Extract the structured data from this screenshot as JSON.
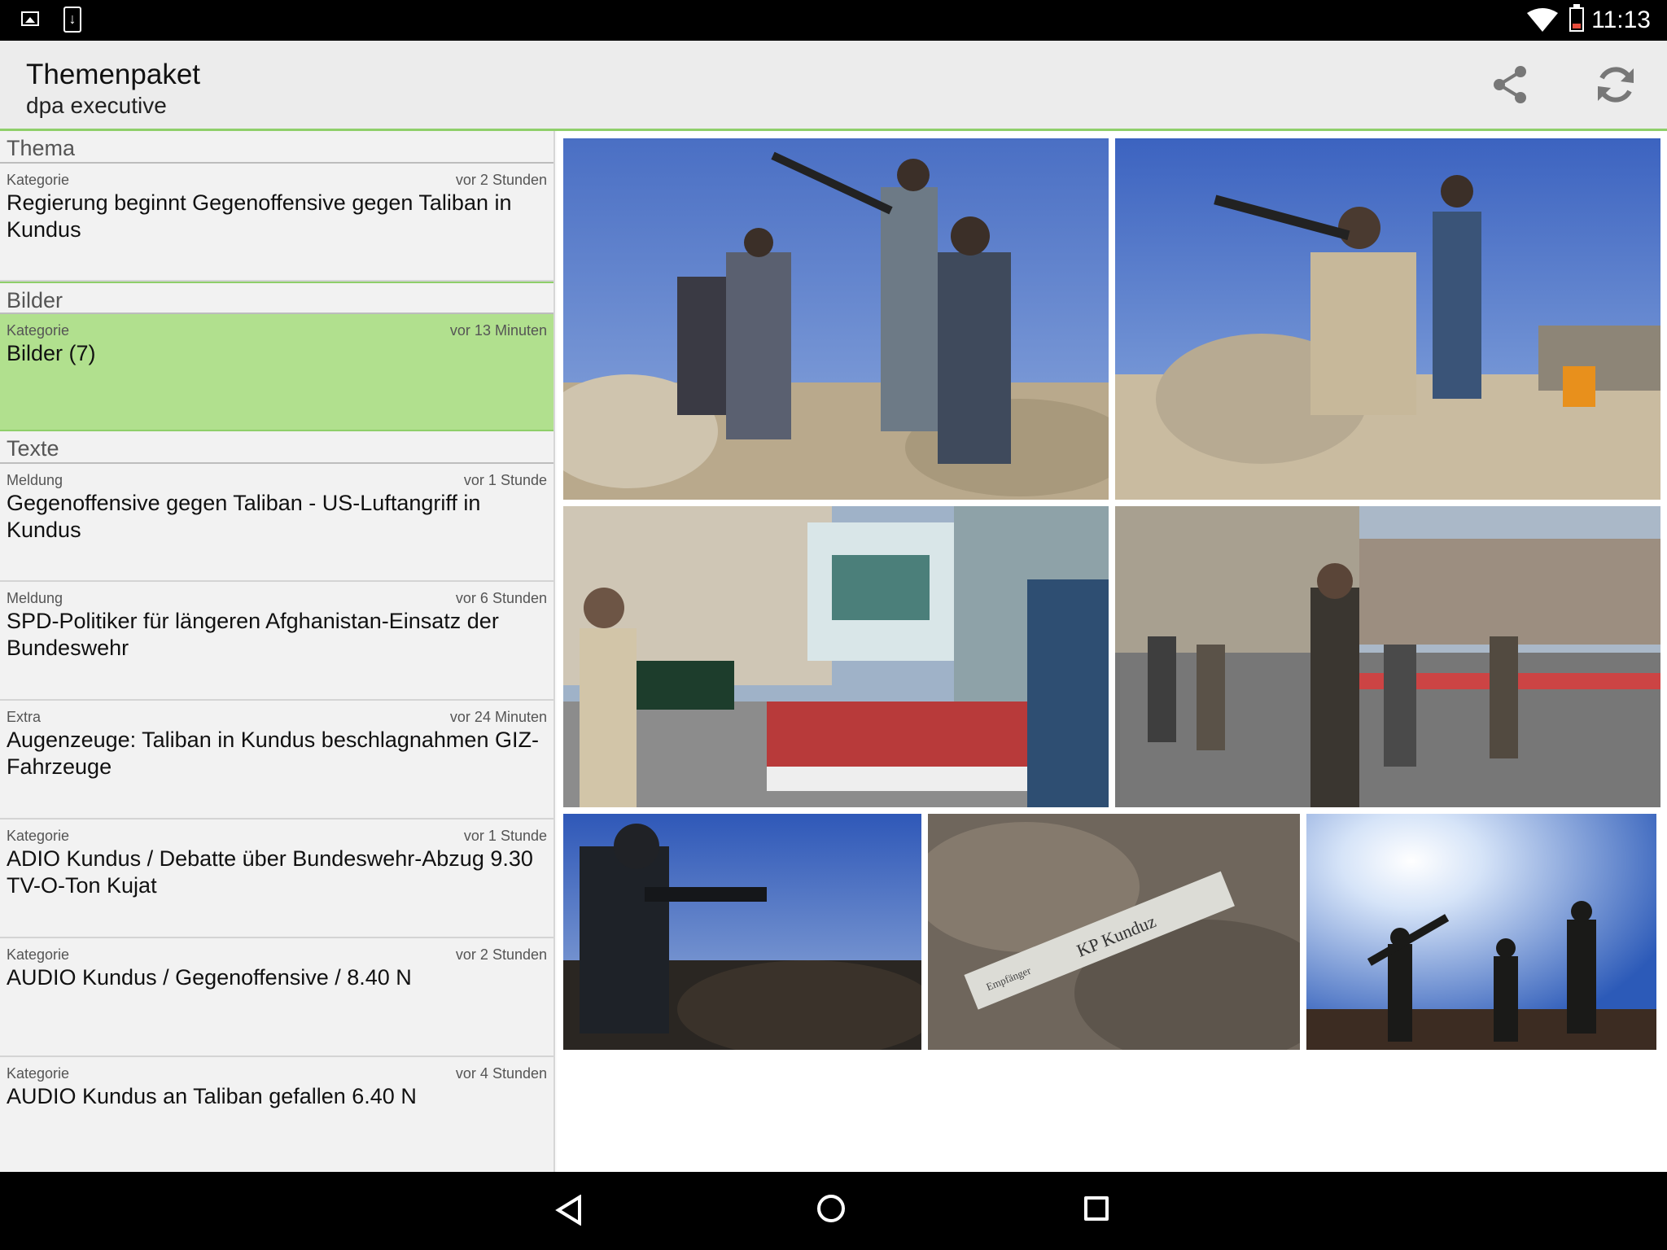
{
  "status_bar": {
    "time": "11:13",
    "icons": [
      "gallery-icon",
      "download-icon",
      "wifi-icon",
      "battery-icon"
    ]
  },
  "action_bar": {
    "title": "Themenpaket",
    "subtitle": "dpa executive",
    "actions": [
      "share-icon",
      "refresh-icon"
    ],
    "accent_color": "#8fcf6a"
  },
  "sections": {
    "thema": {
      "header": "Thema",
      "items": [
        {
          "category": "Kategorie",
          "time": "vor 2 Stunden",
          "title": "Regierung beginnt Gegenoffensive gegen Taliban in Kundus"
        }
      ]
    },
    "bilder": {
      "header": "Bilder",
      "items": [
        {
          "category": "Kategorie",
          "time": "vor 13 Minuten",
          "title": "Bilder (7)"
        }
      ]
    },
    "texte": {
      "header": "Texte",
      "items": [
        {
          "category": "Meldung",
          "time": "vor 1 Stunde",
          "title": "Gegenoffensive gegen Taliban - US-Luftangriff in Kundus"
        },
        {
          "category": "Meldung",
          "time": "vor 6 Stunden",
          "title": "SPD-Politiker für längeren Afghanistan-Einsatz der Bundeswehr"
        },
        {
          "category": "Extra",
          "time": "vor 24 Minuten",
          "title": "Augenzeuge: Taliban in Kundus beschlagnahmen GIZ-Fahrzeuge"
        },
        {
          "category": "Kategorie",
          "time": "vor 1 Stunde",
          "title": "ADIO Kundus / Debatte über Bundeswehr-Abzug 9.30 TV-O-Ton Kujat"
        },
        {
          "category": "Kategorie",
          "time": "vor 2 Stunden",
          "title": "AUDIO Kundus / Gegenoffensive / 8.40 N"
        },
        {
          "category": "Kategorie",
          "time": "vor 4 Stunden",
          "title": "AUDIO Kundus an Taliban gefallen 6.40 N"
        }
      ]
    }
  },
  "photos": {
    "count": 7,
    "sign_text": "KP Kunduz",
    "sign_label": "Empfänger"
  },
  "nav_bar": {
    "buttons": [
      "back-icon",
      "home-icon",
      "recent-apps-icon"
    ]
  }
}
